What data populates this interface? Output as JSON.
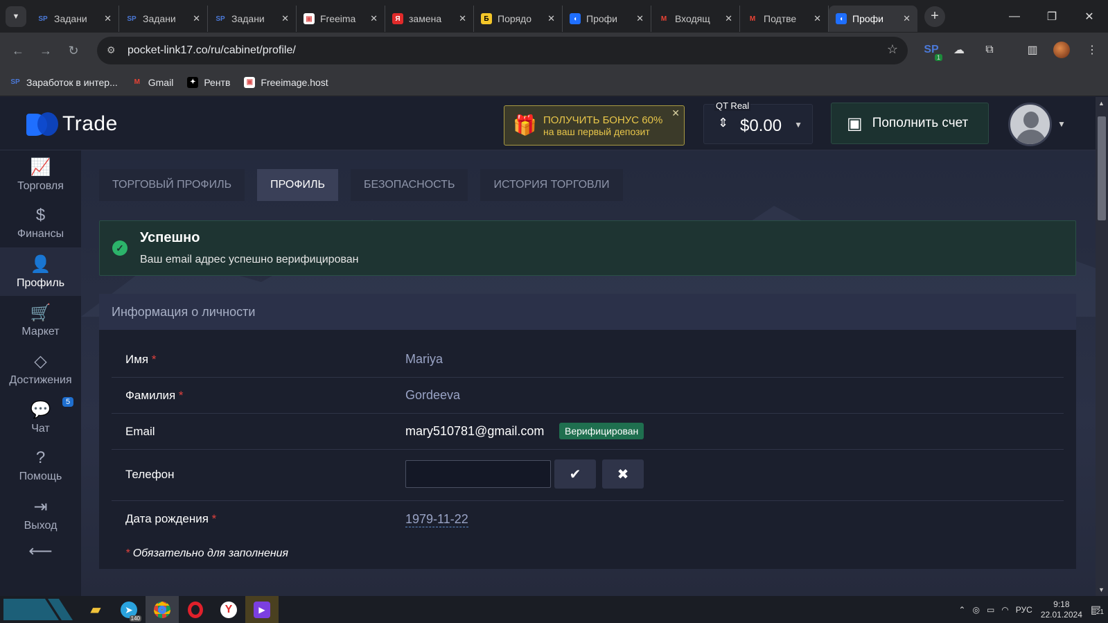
{
  "browser": {
    "tabs": [
      {
        "label": "Задани",
        "icon": "sp-icon",
        "active": false
      },
      {
        "label": "Задани",
        "icon": "sp-icon",
        "active": false
      },
      {
        "label": "Задани",
        "icon": "sp-icon",
        "active": false
      },
      {
        "label": "Freeima",
        "icon": "freeimage-icon",
        "active": false
      },
      {
        "label": "замена",
        "icon": "yandex-icon",
        "active": false
      },
      {
        "label": "Порядо",
        "icon": "b-icon",
        "active": false
      },
      {
        "label": "Профи",
        "icon": "pocket-option-icon",
        "active": false
      },
      {
        "label": "Входящ",
        "icon": "gmail-icon",
        "active": false
      },
      {
        "label": "Подтве",
        "icon": "gmail-icon",
        "active": false
      },
      {
        "label": "Профи",
        "icon": "pocket-option-icon",
        "active": true
      }
    ],
    "url": "pocket-link17.co/ru/cabinet/profile/",
    "ext_badge": "1",
    "bookmarks": [
      {
        "label": "Заработок в интер...",
        "icon": "sp-icon"
      },
      {
        "label": "Gmail",
        "icon": "gmail-icon"
      },
      {
        "label": "Рентв",
        "icon": "rentv-icon"
      },
      {
        "label": "Freeimage.host",
        "icon": "freeimage-icon"
      }
    ]
  },
  "header": {
    "logo_text": "Trade",
    "bonus_line1": "ПОЛУЧИТЬ БОНУС 60%",
    "bonus_line2": "на ваш первый депозит",
    "account_label": "QT Real",
    "balance": "$0.00",
    "deposit_label": "Пополнить счет"
  },
  "sidebar": {
    "items": [
      {
        "label": "Торговля",
        "icon": "chart-icon"
      },
      {
        "label": "Финансы",
        "icon": "dollar-icon"
      },
      {
        "label": "Профиль",
        "icon": "user-icon"
      },
      {
        "label": "Маркет",
        "icon": "cart-icon"
      },
      {
        "label": "Достижения",
        "icon": "diamond-icon"
      },
      {
        "label": "Чат",
        "icon": "chat-icon",
        "badge": "5"
      },
      {
        "label": "Помощь",
        "icon": "help-icon"
      },
      {
        "label": "Выход",
        "icon": "logout-icon"
      }
    ]
  },
  "tabs": [
    {
      "label": "ТОРГОВЫЙ ПРОФИЛЬ"
    },
    {
      "label": "ПРОФИЛЬ"
    },
    {
      "label": "БЕЗОПАСНОСТЬ"
    },
    {
      "label": "ИСТОРИЯ ТОРГОВЛИ"
    }
  ],
  "alert": {
    "title": "Успешно",
    "message": "Ваш email адрес успешно верифицирован"
  },
  "profile": {
    "section_title": "Информация о личности",
    "first_name_label": "Имя",
    "first_name": "Mariya",
    "last_name_label": "Фамилия",
    "last_name": "Gordeeva",
    "email_label": "Email",
    "email": "mary510781@gmail.com",
    "email_status": "Верифицирован",
    "phone_label": "Телефон",
    "phone_value": "",
    "dob_label": "Дата рождения",
    "dob": "1979-11-22",
    "required_mark": "*",
    "required_note": "Обязательно для заполнения"
  },
  "taskbar": {
    "apps": [
      "explorer-icon",
      "telegram-icon",
      "chrome-icon",
      "opera-icon",
      "yandex-browser-icon",
      "app-icon"
    ],
    "telegram_badge": "140",
    "lang": "РУС",
    "time": "9:18",
    "date": "22.01.2024",
    "notifications": "21"
  },
  "colors": {
    "accent_green": "#2cb36a",
    "bonus_gold": "#e8c64a",
    "required_red": "#e0413d",
    "brand_blue": "#1f6fff"
  }
}
